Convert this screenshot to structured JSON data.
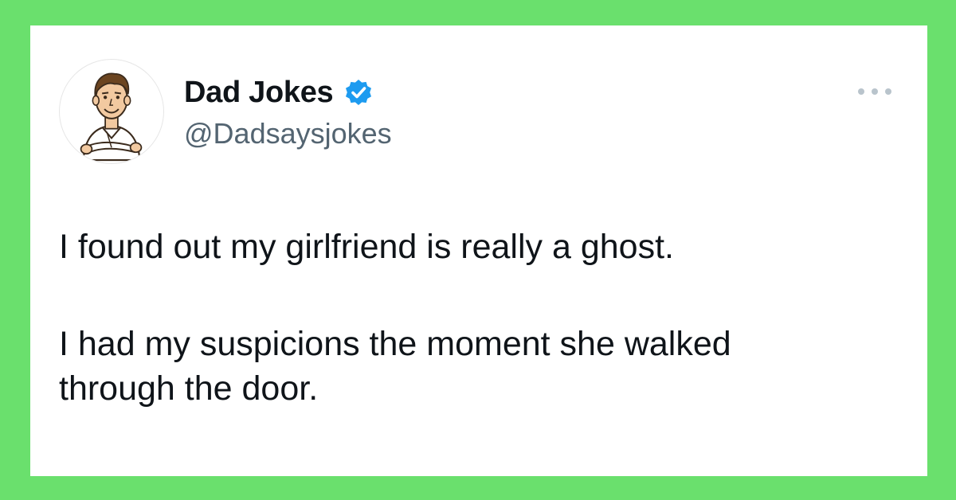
{
  "tweet": {
    "author": {
      "display_name": "Dad Jokes",
      "handle": "@Dadsaysjokes",
      "verified": true,
      "avatar_icon": "cartoon-man-avatar"
    },
    "more_icon": "more-options-icon",
    "text": {
      "paragraph_1": "I found out my girlfriend is really a ghost.",
      "paragraph_2_line_1": "I had my suspicions the moment she walked",
      "paragraph_2_line_2": "through the door."
    }
  },
  "colors": {
    "background": "#6ae06d",
    "card": "#ffffff",
    "text_primary": "#0f1419",
    "text_secondary": "#536471",
    "verified_badge": "#1d9bf0"
  }
}
